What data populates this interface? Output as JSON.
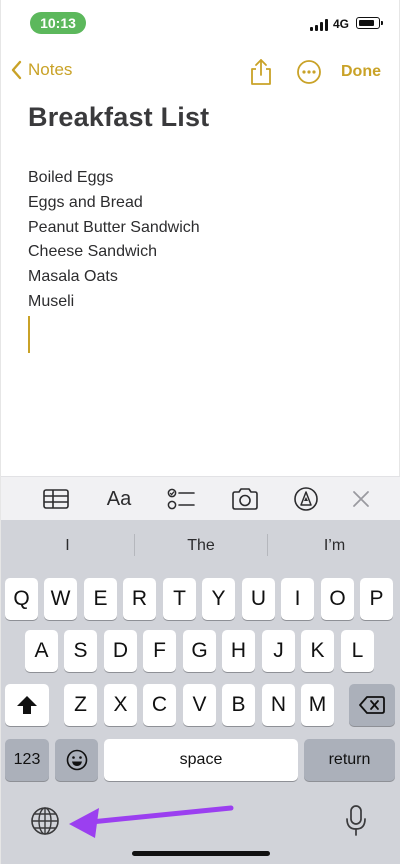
{
  "status_bar": {
    "time": "10:13",
    "network": "4G"
  },
  "nav": {
    "back_label": "Notes",
    "done_label": "Done"
  },
  "note": {
    "title": "Breakfast List",
    "lines": [
      "Boiled Eggs",
      "Eggs and Bread",
      "Peanut Butter Sandwich",
      "Cheese Sandwich",
      "Masala Oats",
      "Museli"
    ]
  },
  "format_toolbar": {
    "text_style_label": "Aa"
  },
  "keyboard": {
    "predictions": [
      "I",
      "The",
      "I’m"
    ],
    "row1": [
      "Q",
      "W",
      "E",
      "R",
      "T",
      "Y",
      "U",
      "I",
      "O",
      "P"
    ],
    "row2": [
      "A",
      "S",
      "D",
      "F",
      "G",
      "H",
      "J",
      "K",
      "L"
    ],
    "row3": [
      "Z",
      "X",
      "C",
      "V",
      "B",
      "N",
      "M"
    ],
    "numbers_label": "123",
    "space_label": "space",
    "return_label": "return"
  },
  "colors": {
    "accent": "#c9a227",
    "status_pill": "#5cb85c",
    "annotation_arrow": "#9b3ff0"
  }
}
